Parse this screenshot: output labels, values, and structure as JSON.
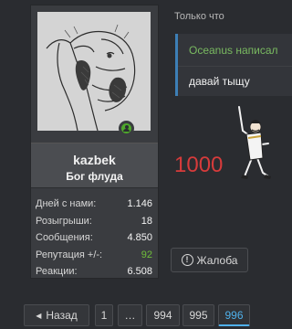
{
  "user": {
    "username": "kazbek",
    "title": "Бог флуда",
    "stats": [
      {
        "label": "Дней с нами:",
        "value": "1.146"
      },
      {
        "label": "Розыгрыши:",
        "value": "18"
      },
      {
        "label": "Сообщения:",
        "value": "4.850"
      },
      {
        "label": "Репутация +/-:",
        "value": "92"
      },
      {
        "label": "Реакции:",
        "value": "6.508"
      }
    ]
  },
  "post": {
    "timestamp": "Только что",
    "quote_author": "Oceanus написал",
    "quote_text": "давай тыщу",
    "body_number": "1000",
    "report_label": "Жалоба"
  },
  "pagination": {
    "prev_label": "Назад",
    "pages": [
      "1",
      "…",
      "994",
      "995",
      "996"
    ],
    "current": "996"
  },
  "colors": {
    "accent": "#4fb0ea",
    "online": "#4ea82b",
    "reputation": "#6fbf3a",
    "quote_author": "#79b960",
    "body_number": "#d63b3b"
  }
}
